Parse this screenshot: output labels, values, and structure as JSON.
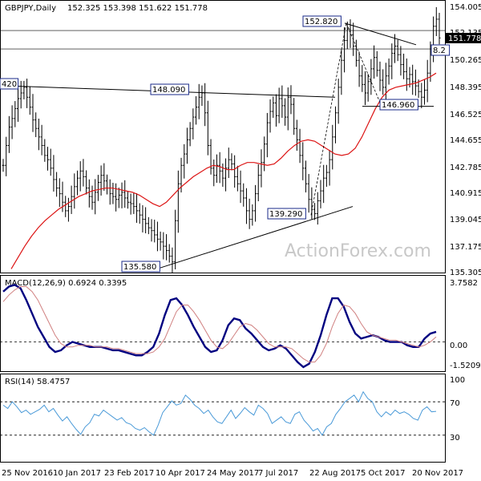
{
  "chart_data": [
    {
      "type": "candlestick",
      "title": "GBPJPY,Daily",
      "ohlc": "152.325 153.398 151.622 151.778",
      "last_price": "151.778",
      "y_ticks": [
        "154.005",
        "152.135",
        "150.265",
        "148.395",
        "146.525",
        "144.655",
        "142.785",
        "140.915",
        "139.045",
        "137.175",
        "135.305"
      ],
      "ylim": [
        135.3,
        154.0
      ],
      "key_levels": [
        {
          "label": "152.820",
          "value": 152.82
        },
        {
          "label": "148.090",
          "value": 148.09
        },
        {
          "label": "146.960",
          "value": 146.96
        },
        {
          "label": "139.290",
          "value": 139.29
        },
        {
          "label": "135.580",
          "value": 135.58
        },
        {
          "label": "420",
          "value": 148.42
        },
        {
          "label": "8.2",
          "value": 151.0
        }
      ],
      "horizontal_lines": [
        152.3,
        151.0
      ],
      "close_series": [
        142.8,
        144.2,
        145.5,
        146.1,
        146.8,
        147.5,
        147.9,
        148.3,
        147.6,
        146.9,
        146.0,
        145.4,
        144.8,
        144.2,
        143.5,
        143.2,
        142.6,
        141.8,
        141.2,
        140.8,
        140.2,
        139.6,
        139.9,
        140.6,
        141.3,
        141.9,
        142.4,
        142.0,
        141.2,
        140.6,
        140.2,
        140.9,
        141.6,
        142.1,
        141.7,
        141.2,
        140.8,
        140.6,
        140.4,
        140.7,
        140.9,
        140.5,
        140.2,
        140.1,
        139.9,
        139.6,
        139.3,
        139.0,
        138.7,
        138.4,
        138.2,
        137.9,
        137.6,
        137.4,
        137.1,
        136.8,
        136.4,
        136.0,
        138.9,
        141.5,
        142.8,
        143.6,
        144.6,
        145.4,
        146.2,
        146.9,
        147.6,
        147.9,
        146.5,
        144.2,
        142.6,
        142.1,
        142.8,
        142.4,
        141.9,
        142.6,
        143.2,
        142.9,
        142.0,
        141.5,
        141.0,
        140.5,
        139.6,
        139.0,
        139.6,
        140.8,
        142.1,
        143.0,
        144.3,
        145.8,
        146.6,
        147.2,
        146.3,
        147.5,
        147.0,
        146.2,
        147.6,
        147.1,
        145.4,
        144.6,
        143.5,
        142.6,
        141.5,
        140.4,
        139.7,
        139.4,
        140.3,
        141.0,
        141.9,
        142.3,
        143.2,
        144.8,
        146.5,
        148.3,
        150.2,
        151.6,
        152.4,
        152.0,
        151.2,
        150.2,
        149.1,
        148.5,
        147.9,
        148.7,
        149.6,
        150.4,
        149.5,
        148.8,
        148.3,
        149.1,
        149.8,
        150.7,
        151.2,
        150.6,
        149.9,
        149.4,
        148.9,
        149.2,
        148.7,
        148.4,
        148.0,
        147.6,
        148.1,
        149.3,
        151.0,
        152.6,
        153.1,
        151.778
      ],
      "moving_average": [
        135.5,
        136.3,
        137.1,
        137.8,
        138.4,
        138.9,
        139.3,
        139.7,
        140.0,
        140.3,
        140.6,
        140.8,
        141.0,
        141.1,
        141.2,
        141.2,
        141.1,
        141.0,
        140.9,
        140.7,
        140.4,
        140.1,
        139.9,
        140.2,
        140.7,
        141.2,
        141.6,
        142.0,
        142.3,
        142.6,
        142.8,
        142.7,
        142.5,
        142.5,
        142.8,
        143.0,
        143.0,
        142.9,
        142.8,
        142.9,
        143.3,
        143.8,
        144.2,
        144.5,
        144.6,
        144.5,
        144.2,
        143.9,
        143.6,
        143.5,
        143.6,
        144.0,
        144.8,
        145.8,
        146.8,
        147.6,
        148.1,
        148.3,
        148.4,
        148.5,
        148.6,
        148.8,
        149.0,
        149.3
      ],
      "trendlines": [
        {
          "from": 148.42,
          "to": 147.6
        },
        {
          "from": 135.58,
          "to": 139.9
        },
        {
          "from": 152.82,
          "to": 151.3
        }
      ]
    },
    {
      "type": "line",
      "title": "MACD(12,26,9) 0.6924 0.3395",
      "y_ticks": [
        "3.7582",
        "0.00",
        "-1.5209"
      ],
      "ylim": [
        -1.6,
        3.8
      ],
      "series": [
        {
          "name": "MACD",
          "values": [
            3.0,
            3.3,
            3.4,
            3.2,
            2.5,
            1.7,
            0.9,
            0.3,
            -0.3,
            -0.6,
            -0.5,
            -0.2,
            0.0,
            -0.1,
            -0.2,
            -0.3,
            -0.3,
            -0.3,
            -0.4,
            -0.5,
            -0.5,
            -0.6,
            -0.7,
            -0.8,
            -0.8,
            -0.6,
            -0.3,
            0.5,
            1.6,
            2.5,
            2.6,
            2.2,
            1.6,
            0.9,
            0.3,
            -0.3,
            -0.6,
            -0.5,
            0.1,
            1.0,
            1.4,
            1.3,
            0.8,
            0.5,
            0.1,
            -0.3,
            -0.5,
            -0.4,
            -0.2,
            -0.4,
            -0.8,
            -1.2,
            -1.5,
            -1.3,
            -0.6,
            0.4,
            1.6,
            2.6,
            2.6,
            2.1,
            1.2,
            0.5,
            0.2,
            0.3,
            0.4,
            0.3,
            0.1,
            0.0,
            0.0,
            0.0,
            -0.2,
            -0.3,
            -0.3,
            0.2,
            0.5,
            0.6
          ]
        },
        {
          "name": "Signal",
          "values": [
            2.4,
            2.8,
            3.1,
            3.3,
            3.3,
            3.0,
            2.5,
            1.8,
            1.1,
            0.4,
            -0.1,
            -0.3,
            -0.3,
            -0.2,
            -0.2,
            -0.2,
            -0.3,
            -0.3,
            -0.3,
            -0.4,
            -0.4,
            -0.5,
            -0.6,
            -0.7,
            -0.7,
            -0.7,
            -0.6,
            -0.3,
            0.2,
            1.0,
            1.8,
            2.2,
            2.2,
            1.8,
            1.3,
            0.7,
            0.1,
            -0.3,
            -0.4,
            -0.1,
            0.4,
            0.9,
            1.1,
            1.0,
            0.7,
            0.3,
            -0.1,
            -0.3,
            -0.3,
            -0.3,
            -0.4,
            -0.7,
            -1.0,
            -1.2,
            -1.2,
            -0.8,
            -0.1,
            0.9,
            1.7,
            2.2,
            2.1,
            1.7,
            1.1,
            0.6,
            0.4,
            0.3,
            0.2,
            0.1,
            0.1,
            0.0,
            -0.1,
            -0.2,
            -0.3,
            -0.2,
            0.0,
            0.3
          ]
        }
      ]
    },
    {
      "type": "line",
      "title": "RSI(14) 58.4757",
      "y_ticks": [
        "100",
        "70",
        "30",
        "0"
      ],
      "ylim": [
        0,
        100
      ],
      "levels": [
        70,
        30
      ],
      "series": [
        {
          "name": "RSI",
          "values": [
            66,
            62,
            70,
            64,
            57,
            60,
            55,
            58,
            61,
            66,
            58,
            62,
            54,
            47,
            52,
            44,
            37,
            31,
            40,
            45,
            55,
            53,
            60,
            56,
            52,
            48,
            51,
            45,
            43,
            38,
            36,
            39,
            34,
            30,
            42,
            57,
            64,
            71,
            66,
            68,
            78,
            73,
            66,
            62,
            56,
            60,
            52,
            46,
            44,
            52,
            60,
            50,
            56,
            63,
            58,
            54,
            66,
            62,
            56,
            44,
            48,
            52,
            46,
            44,
            55,
            58,
            48,
            42,
            35,
            38,
            30,
            40,
            44,
            55,
            62,
            70,
            74,
            78,
            70,
            82,
            74,
            70,
            58,
            52,
            58,
            54,
            60,
            56,
            58,
            55,
            50,
            48,
            60,
            64,
            58,
            58.4757
          ]
        }
      ]
    },
    {
      "type": "axis",
      "x_ticks": [
        "25 Nov 2016",
        "10 Jan 2017",
        "23 Feb 2017",
        "10 Apr 2017",
        "24 May 2017",
        "7 Jul 2017",
        "22 Aug 2017",
        "5 Oct 2017",
        "20 Nov 2017"
      ]
    }
  ],
  "watermark": "ActionForex.com",
  "colors": {
    "price": "#000000",
    "moving_average": "#dc1414",
    "macd": "#000080",
    "signal": "#d08080",
    "rsi": "#4a9ad8",
    "grid": "#000000",
    "last_price_bg": "#000000"
  }
}
